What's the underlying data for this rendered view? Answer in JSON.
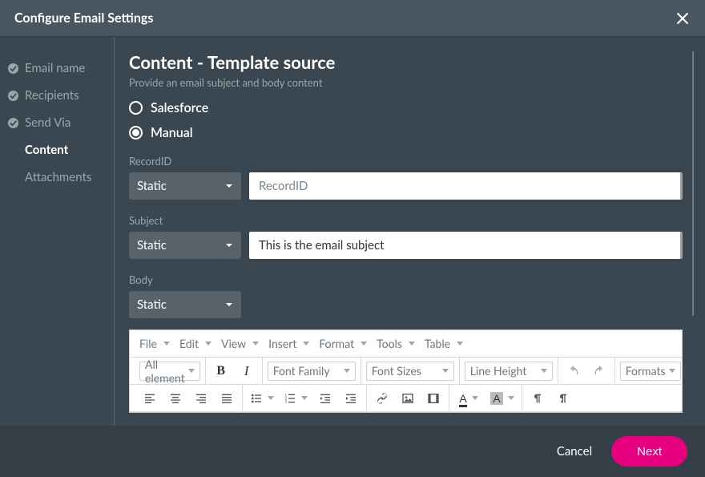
{
  "header": {
    "title": "Configure Email Settings"
  },
  "sidebar": {
    "items": [
      {
        "label": "Email name",
        "done": true,
        "active": false
      },
      {
        "label": "Recipients",
        "done": true,
        "active": false
      },
      {
        "label": "Send Via",
        "done": true,
        "active": false
      },
      {
        "label": "Content",
        "done": false,
        "active": true
      },
      {
        "label": "Attachments",
        "done": false,
        "active": false
      }
    ]
  },
  "content": {
    "heading": "Content - Template source",
    "subtitle": "Provide an email subject and body content",
    "radios": {
      "salesforce": "Salesforce",
      "manual": "Manual",
      "selected": "manual"
    },
    "record_id": {
      "label": "RecordID",
      "type": "Static",
      "placeholder": "RecordID",
      "value": ""
    },
    "subject": {
      "label": "Subject",
      "type": "Static",
      "value": "This is the email subject"
    },
    "body": {
      "label": "Body",
      "type": "Static"
    }
  },
  "editor": {
    "menus": [
      "File",
      "Edit",
      "View",
      "Insert",
      "Format",
      "Tools",
      "Table"
    ],
    "dropdowns": {
      "elements": "All element",
      "font_family": "Font Family",
      "font_sizes": "Font Sizes",
      "line_height": "Line Height",
      "formats": "Formats"
    }
  },
  "footer": {
    "cancel": "Cancel",
    "next": "Next"
  },
  "colors": {
    "accent": "#e6007e",
    "panel": "#3b4750",
    "header": "#4a565f"
  }
}
